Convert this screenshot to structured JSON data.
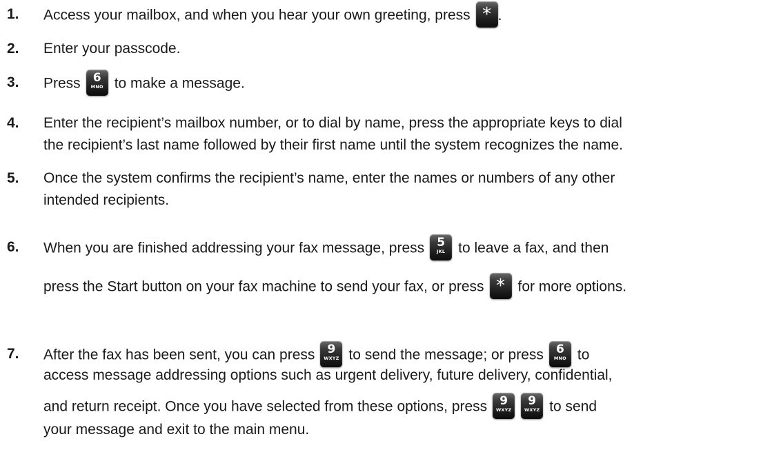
{
  "steps": [
    {
      "number": "1.",
      "lines": [
        {
          "before": "Access your mailbox, and when you hear your own greeting, press",
          "key": {
            "digit": "*",
            "letters": ""
          },
          "after": "."
        }
      ]
    },
    {
      "number": "2.",
      "lines": [
        {
          "text": "Enter your passcode."
        }
      ]
    },
    {
      "number": "3.",
      "lines": [
        {
          "before": "Press",
          "key": {
            "digit": "6",
            "letters": "MNO"
          },
          "after": "to make a message."
        }
      ]
    },
    {
      "number": "4.",
      "lines": [
        {
          "text": "Enter the recipient’s mailbox number, or to dial by name, press the appropriate keys to dial"
        },
        {
          "text": "the recipient’s last name followed by their first name until the system recognizes the name."
        }
      ]
    },
    {
      "number": "5.",
      "lines": [
        {
          "text": "Once the system confirms the recipient’s name, enter the names or numbers of any other"
        },
        {
          "text": "intended recipients."
        }
      ]
    },
    {
      "number": "6.",
      "lines": [
        {
          "before": "When you are finished addressing your fax message, press",
          "key": {
            "digit": "5",
            "letters": "JKL"
          },
          "after": "to leave a fax, and then"
        },
        {
          "before": "press the Start button on your fax machine to send your fax, or press",
          "key": {
            "digit": "*",
            "letters": ""
          },
          "after": "for more options."
        }
      ]
    },
    {
      "number": "7.",
      "lines": [
        {
          "before": "After the fax has been sent, you can press",
          "key": {
            "digit": "9",
            "letters": "WXYZ"
          },
          "middle": "to send the message; or press",
          "key2": {
            "digit": "6",
            "letters": "MNO"
          },
          "after": "to"
        },
        {
          "text": "access message addressing options such as urgent delivery, future delivery, confidential,"
        },
        {
          "before": "and return receipt. Once you have selected from these options, press",
          "key": {
            "digit": "9",
            "letters": "WXYZ"
          },
          "middle": "",
          "key2": {
            "digit": "9",
            "letters": "WXYZ"
          },
          "after": "to send"
        },
        {
          "text": "your message and exit to the main menu."
        }
      ]
    }
  ]
}
